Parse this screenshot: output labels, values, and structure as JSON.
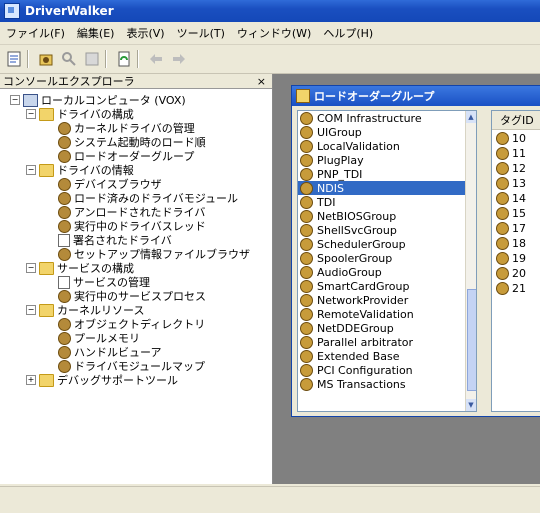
{
  "window": {
    "title": "DriverWalker"
  },
  "menu": [
    "ファイル(F)",
    "編集(E)",
    "表示(V)",
    "ツール(T)",
    "ウィンドウ(W)",
    "ヘルプ(H)"
  ],
  "left_pane": {
    "header": "コンソールエクスプローラ",
    "close": "×",
    "tree": [
      {
        "label": "ローカルコンピュータ (VOX)",
        "icon": "computer-icon",
        "level": 0,
        "expander": "−"
      },
      {
        "label": "ドライバの構成",
        "icon": "folder-icon",
        "level": 1,
        "expander": "−"
      },
      {
        "label": "カーネルドライバの管理",
        "icon": "gear-icon",
        "level": 2
      },
      {
        "label": "システム起動時のロード順",
        "icon": "gear-icon",
        "level": 2
      },
      {
        "label": "ロードオーダーグループ",
        "icon": "gear-icon",
        "level": 2
      },
      {
        "label": "ドライバの情報",
        "icon": "folder-icon",
        "level": 1,
        "expander": "−"
      },
      {
        "label": "デバイスブラウザ",
        "icon": "gear-icon",
        "level": 2
      },
      {
        "label": "ロード済みのドライバモジュール",
        "icon": "gear-icon",
        "level": 2
      },
      {
        "label": "アンロードされたドライバ",
        "icon": "gear-icon",
        "level": 2
      },
      {
        "label": "実行中のドライバスレッド",
        "icon": "gear-icon",
        "level": 2
      },
      {
        "label": "署名されたドライバ",
        "icon": "doc-icon",
        "level": 2
      },
      {
        "label": "セットアップ情報ファイルブラウザ",
        "icon": "gear-icon",
        "level": 2
      },
      {
        "label": "サービスの構成",
        "icon": "folder-icon",
        "level": 1,
        "expander": "−"
      },
      {
        "label": "サービスの管理",
        "icon": "doc-icon",
        "level": 2
      },
      {
        "label": "実行中のサービスプロセス",
        "icon": "gear-icon",
        "level": 2
      },
      {
        "label": "カーネルリソース",
        "icon": "folder-icon",
        "level": 1,
        "expander": "−"
      },
      {
        "label": "オブジェクトディレクトリ",
        "icon": "gear-icon",
        "level": 2
      },
      {
        "label": "プールメモリ",
        "icon": "gear-icon",
        "level": 2
      },
      {
        "label": "ハンドルビューア",
        "icon": "gear-icon",
        "level": 2
      },
      {
        "label": "ドライバモジュールマップ",
        "icon": "gear-icon",
        "level": 2
      },
      {
        "label": "デバッグサポートツール",
        "icon": "folder-icon",
        "level": 1,
        "expander": "+"
      }
    ]
  },
  "child_window": {
    "title": "ロードオーダーグループ",
    "groups": [
      "COM Infrastructure",
      "UIGroup",
      "LocalValidation",
      "PlugPlay",
      "PNP_TDI",
      "NDIS",
      "TDI",
      "NetBIOSGroup",
      "ShellSvcGroup",
      "SchedulerGroup",
      "SpoolerGroup",
      "AudioGroup",
      "SmartCardGroup",
      "NetworkProvider",
      "RemoteValidation",
      "NetDDEGroup",
      "Parallel arbitrator",
      "Extended Base",
      "PCI Configuration",
      "MS Transactions"
    ],
    "selected_group": "NDIS",
    "tag_header": "タグID",
    "tags": [
      "10",
      "11",
      "12",
      "13",
      "14",
      "15",
      "17",
      "18",
      "19",
      "20",
      "21"
    ]
  }
}
